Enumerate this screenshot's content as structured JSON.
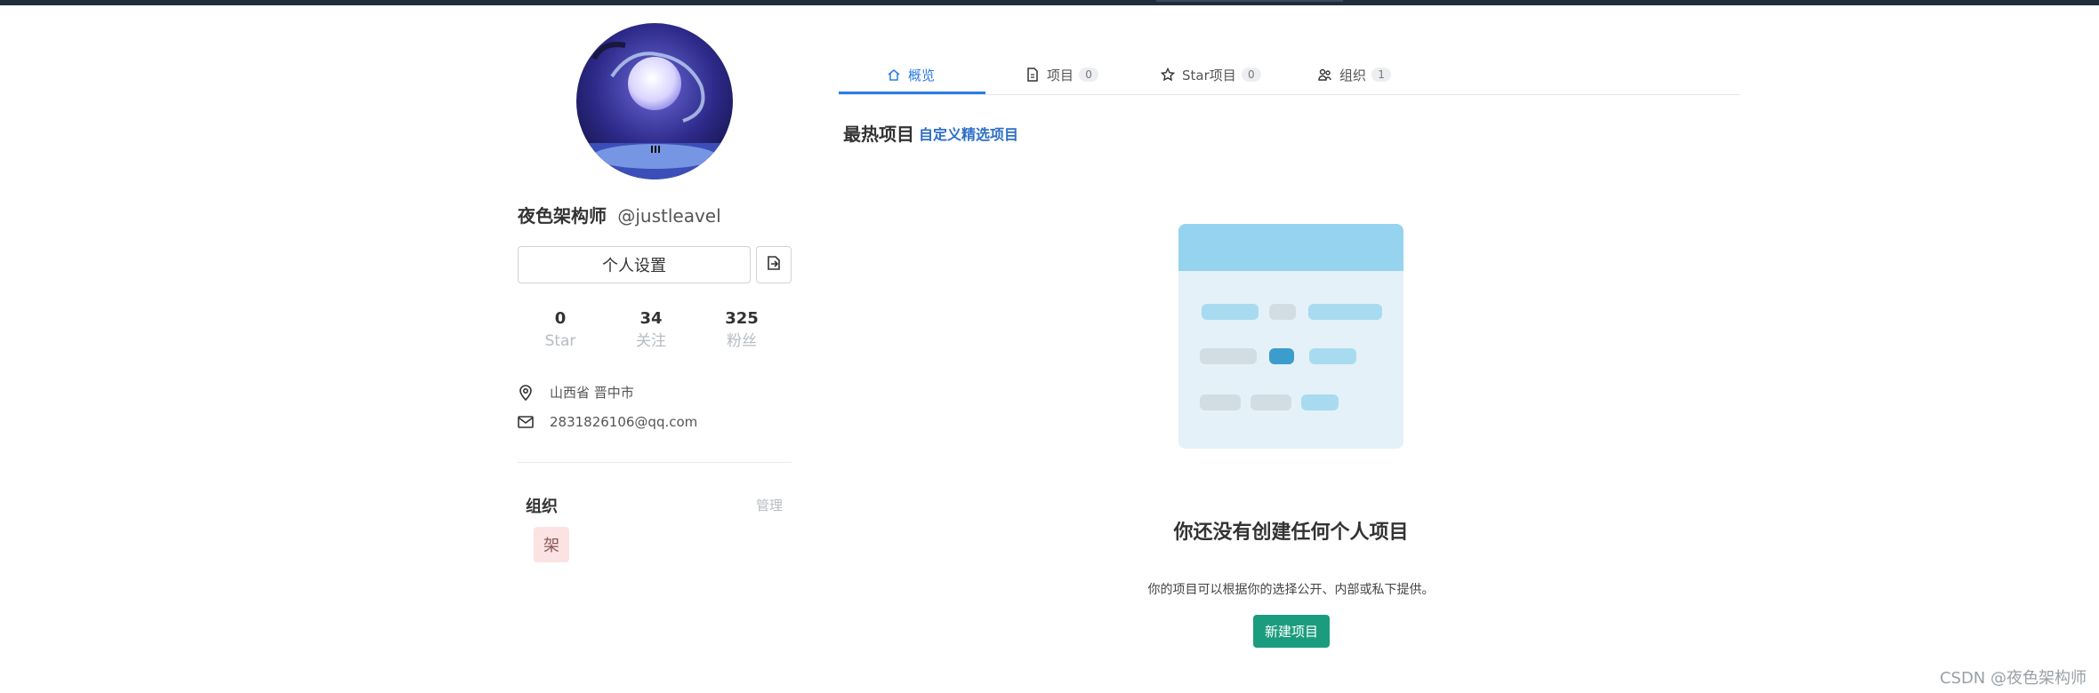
{
  "profile": {
    "name": "夜色架构师",
    "handle": "@justleavel",
    "settings_label": "个人设置",
    "export_icon": "export-icon"
  },
  "stats": [
    {
      "value": "0",
      "label": "Star"
    },
    {
      "value": "34",
      "label": "关注"
    },
    {
      "value": "325",
      "label": "粉丝"
    }
  ],
  "info": {
    "location": "山西省 晋中市",
    "email": "2831826106@qq.com"
  },
  "organizations": {
    "title": "组织",
    "manage_label": "管理",
    "items": [
      {
        "label": "架"
      }
    ]
  },
  "tabs": [
    {
      "label": "概览",
      "badge": null,
      "icon": "home-icon"
    },
    {
      "label": "项目",
      "badge": "0",
      "icon": "file-icon"
    },
    {
      "label": "Star项目",
      "badge": "0",
      "icon": "star-icon"
    },
    {
      "label": "组织",
      "badge": "1",
      "icon": "org-icon"
    }
  ],
  "section": {
    "title": "最热项目",
    "link": "自定义精选项目"
  },
  "empty_state": {
    "title": "你还没有创建任何个人项目",
    "description": "你的项目可以根据你的选择公开、内部或私下提供。",
    "button_label": "新建项目"
  },
  "watermark": "CSDN @夜色架构师",
  "colors": {
    "accent": "#2c7be5",
    "primary_button": "#1c9c7e",
    "org_chip": "#fbe3e3"
  }
}
